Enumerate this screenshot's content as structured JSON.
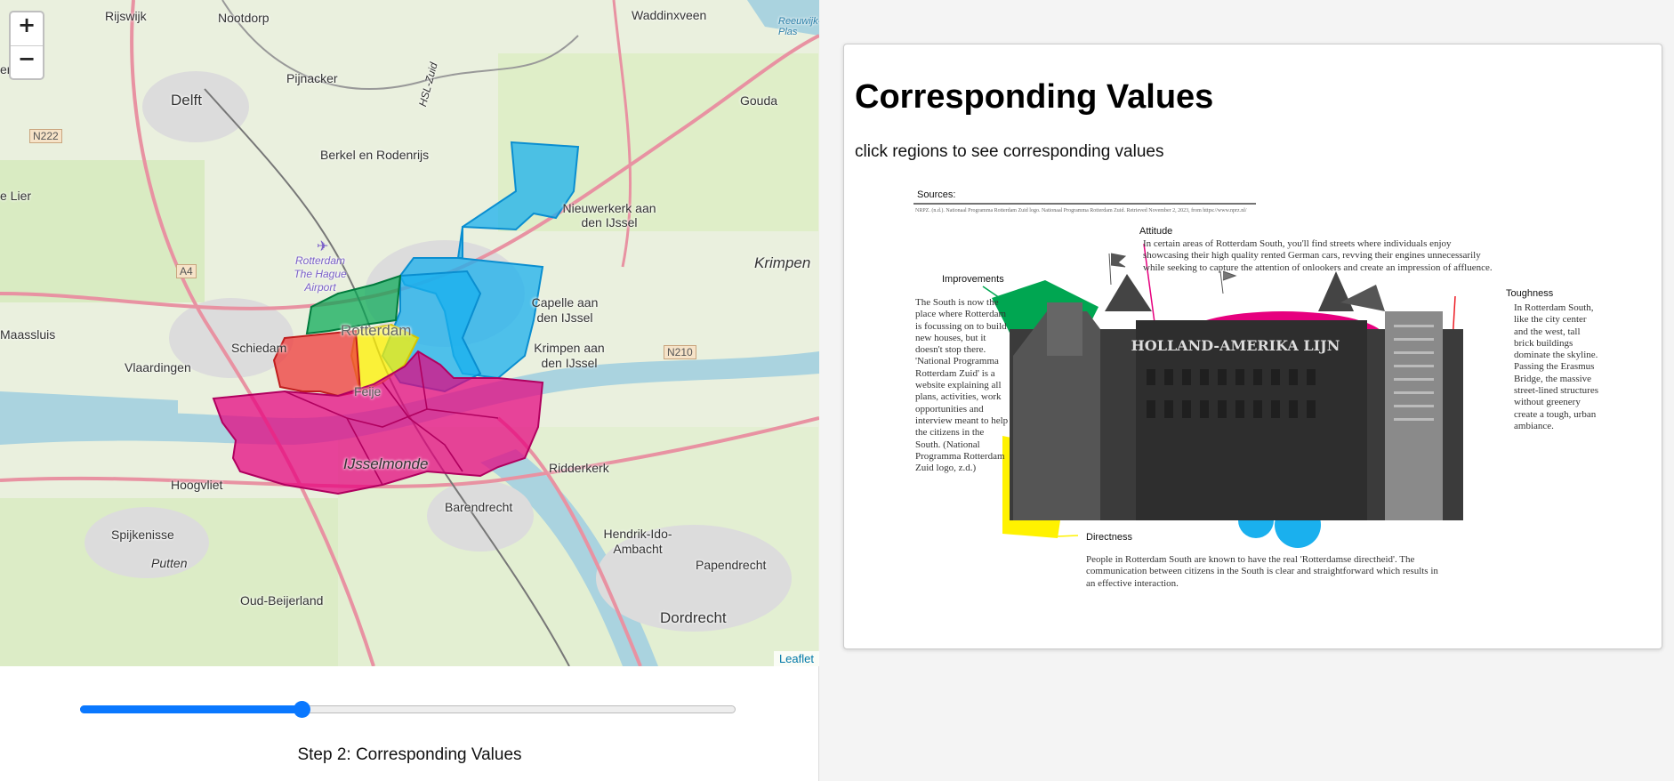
{
  "map": {
    "zoom_in": "+",
    "zoom_out": "−",
    "attribution": "Leaflet",
    "places": {
      "rijswijk": "Rijswijk",
      "nootdorp": "Nootdorp",
      "waddinxveen": "Waddinxveen",
      "reeuwijk": "Reeuwijk-Plas",
      "eringen": "eringen",
      "delft": "Delft",
      "pijnacker": "Pijnacker",
      "gouda": "Gouda",
      "berkel": "Berkel en Rodenrijs",
      "lier": "e Lier",
      "nieuwerkerk": "Nieuwerkerk aan den IJssel",
      "krimpen": "Krimpen",
      "airport": "Rotterdam The Hague Airport",
      "capelle": "Capelle aan den IJssel",
      "maassluis": "Maassluis",
      "schiedam": "Schiedam",
      "rotterdam": "Rotterdam",
      "krimpen2": "Krimpen aan den IJssel",
      "vlaardingen": "Vlaardingen",
      "ijsselmonde": "IJsselmonde",
      "ridderkerk": "Ridderkerk",
      "hoogvliet": "Hoogvliet",
      "barendrecht": "Barendrecht",
      "spijkenisse": "Spijkenisse",
      "hendrik": "Hendrik-Ido-Ambacht",
      "papendrecht": "Papendrecht",
      "putten": "Putten",
      "oud": "Oud-Beijerland",
      "dordrecht": "Dordrecht",
      "hsl": "HSL-Zuid",
      "feijenoord": "Feije"
    },
    "roads": {
      "n222": "N222",
      "a4": "A4",
      "n210": "N210"
    },
    "region_colors": {
      "green": "#00a651",
      "blue": "#1ab0ee",
      "yellow": "#fff200",
      "red": "#ef3b3b",
      "magenta": "#e6007e"
    }
  },
  "slider": {
    "value": 2,
    "label": "Step 2: Corresponding Values"
  },
  "panel": {
    "title": "Corresponding Values",
    "subtitle": "click regions to see corresponding values",
    "poster": {
      "sources_label": "Sources:",
      "source_ref": "NRPZ. (n.d.). Nationaal Programma Rotterdam Zuid logo. Nationaal Programma Rotterdam Zuid. Retrieved November 2, 2023, from https://www.nprz.nl/",
      "building_sign": "HOLLAND-AMERIKA LIJN",
      "improvements_title": "Improvements",
      "improvements_text": "The South is now the place where Rotterdam is focussing on to build new houses, but it doesn't stop there. 'National Programma Rotterdam Zuid' is a website explaining all plans, activities, work opportunities and interview meant to help the citizens in the South. (National Programma Rotterdam Zuid logo, z.d.)",
      "attitude_title": "Attitude",
      "attitude_text": "In certain areas of Rotterdam South, you'll find streets where individuals enjoy showcasing their high quality rented German cars, revving their engines unnecessarily while seeking to capture the attention of onlookers and create an impression of affluence.",
      "toughness_title": "Toughness",
      "toughness_text": "In Rotterdam South, like the city center and the west, tall brick buildings dominate the skyline. Passing the Erasmus Bridge, the massive street-lined structures without greenery create a tough, urban ambiance.",
      "directness_title": "Directness",
      "directness_text": "People in Rotterdam South are known to have the real 'Rotterdamse directheid'. The communication between citizens in the South is clear and straightforward which results in an effective interaction."
    }
  }
}
